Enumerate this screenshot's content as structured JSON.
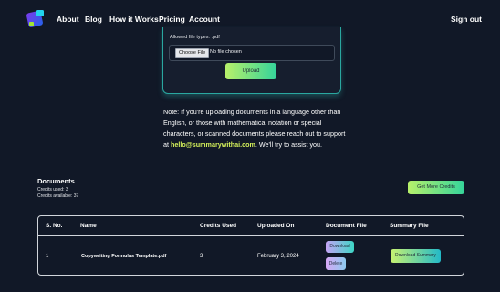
{
  "nav": {
    "links": [
      "About",
      "Blog",
      "How it Works",
      "Pricing",
      "Account"
    ],
    "sign_out": "Sign out"
  },
  "upload": {
    "allowed_types": "Allowed file types: .pdf",
    "choose_file": "Choose File",
    "no_file": "No file chosen",
    "upload_label": "Upload"
  },
  "note": {
    "text_before": "Note: If you're uploading documents in a language other than English, or those with mathematical notation or special characters, or scanned documents please reach out to support at ",
    "email": "hello@summarywithai.com",
    "text_after": ". We'll try to assist you."
  },
  "documents": {
    "title": "Documents",
    "credits_used": "Credits used: 3",
    "credits_available": "Credits available: 37",
    "get_more_credits": "Get More Credits"
  },
  "table": {
    "headers": [
      "S. No.",
      "Name",
      "Credits Used",
      "Uploaded On",
      "Document File",
      "Summary File"
    ],
    "rows": [
      {
        "sno": "1",
        "name": "Copywriting Formulas Template.pdf",
        "credits": "3",
        "uploaded": "February 3, 2024",
        "download": "Download",
        "delete": "Delete",
        "download_summary": "Download Summary"
      }
    ]
  },
  "colors": {
    "background": "#111827",
    "accent_gradient_start": "#b7f06a",
    "accent_gradient_end": "#35d49b",
    "email_highlight": "#d4f05a",
    "card_border": "#2aa7a0"
  },
  "icons": {
    "logo": "app-logo-icon"
  }
}
